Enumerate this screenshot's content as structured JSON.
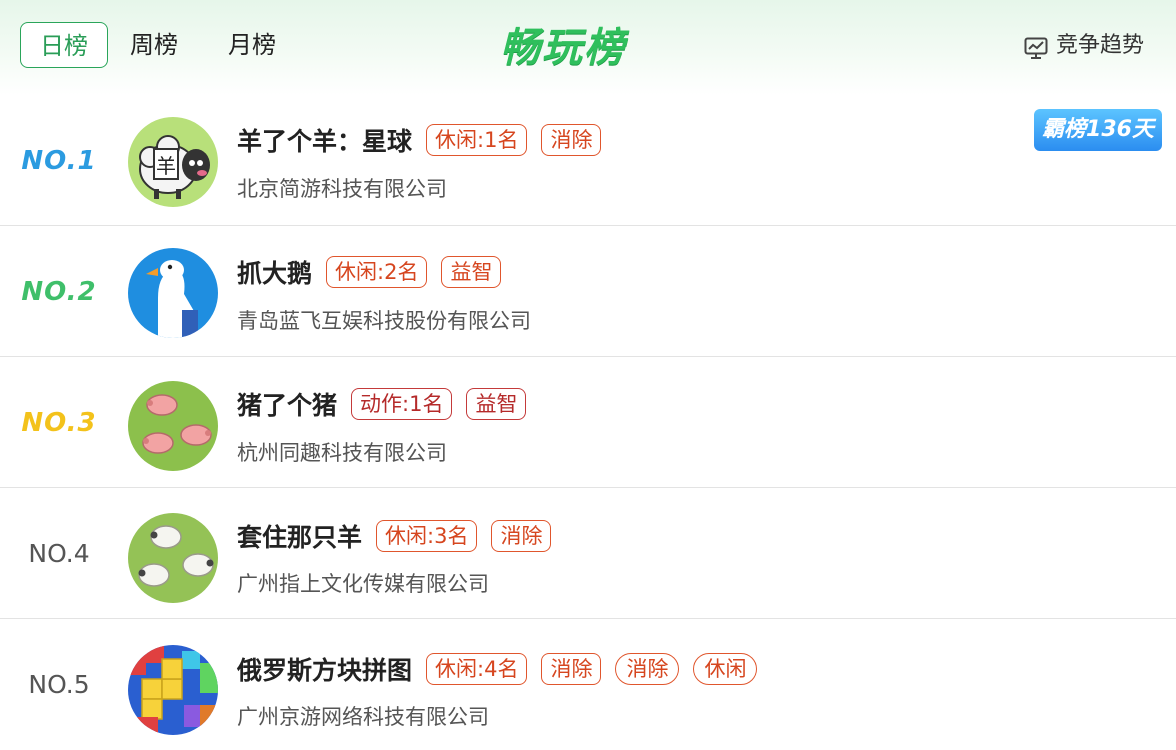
{
  "tabs": {
    "day": "日榜",
    "week": "周榜",
    "month": "月榜"
  },
  "title": "畅玩榜",
  "trend_label": "竞争趋势",
  "rank_colors": {
    "no1": "#2b9be0",
    "no2": "#3fbf6a",
    "no3": "#f3c21b",
    "accent": "#2aa55a"
  },
  "rows": [
    {
      "rank": "NO.1",
      "name": "羊了个羊：星球",
      "tags": [
        "休闲:1名",
        "消除"
      ],
      "company": "北京简游科技有限公司",
      "badge": "霸榜136天"
    },
    {
      "rank": "NO.2",
      "name": "抓大鹅",
      "tags": [
        "休闲:2名",
        "益智"
      ],
      "company": "青岛蓝飞互娱科技股份有限公司"
    },
    {
      "rank": "NO.3",
      "name": "猪了个猪",
      "tags": [
        "动作:1名",
        "益智"
      ],
      "company": "杭州同趣科技有限公司"
    },
    {
      "rank": "NO.4",
      "name": "套住那只羊",
      "tags": [
        "休闲:3名",
        "消除"
      ],
      "company": "广州指上文化传媒有限公司"
    },
    {
      "rank": "NO.5",
      "name": "俄罗斯方块拼图",
      "tags": [
        "休闲:4名",
        "消除",
        "消除",
        "休闲"
      ],
      "company": "广州京游网络科技有限公司"
    }
  ]
}
